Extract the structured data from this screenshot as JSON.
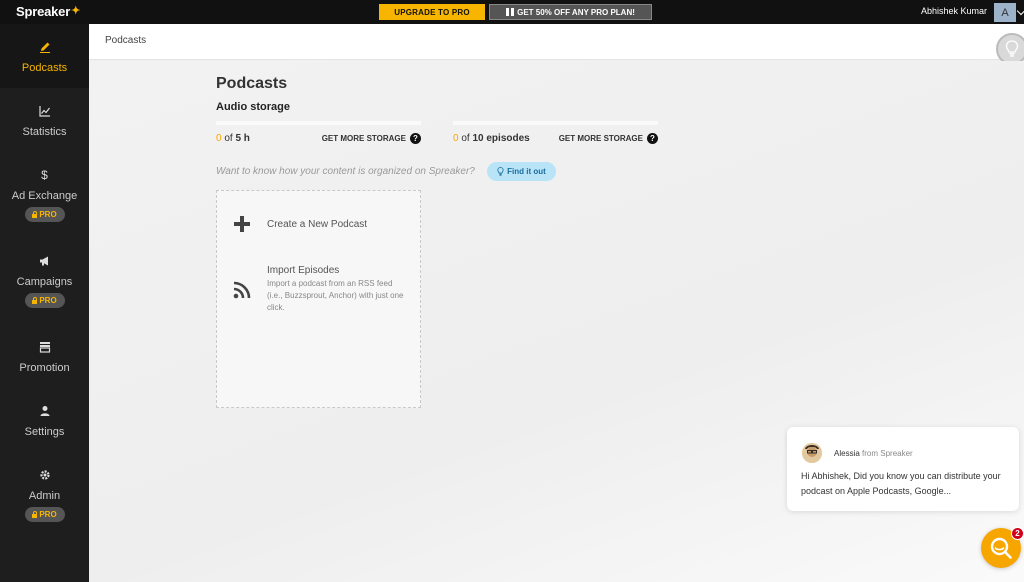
{
  "topbar": {
    "logo": "Spreaker",
    "upgrade_label": "UPGRADE TO PRO",
    "offer_label": "GET 50% OFF ANY PRO PLAN!",
    "user_name": "Abhishek Kumar",
    "avatar_initial": "A"
  },
  "sidebar": {
    "items": [
      {
        "label": "Podcasts",
        "icon": "pencil-icon",
        "active": true,
        "pro": false
      },
      {
        "label": "Statistics",
        "icon": "chart-icon",
        "active": false,
        "pro": false
      },
      {
        "label": "Ad Exchange",
        "icon": "dollar-icon",
        "active": false,
        "pro": true
      },
      {
        "label": "Campaigns",
        "icon": "megaphone-icon",
        "active": false,
        "pro": true
      },
      {
        "label": "Promotion",
        "icon": "store-icon",
        "active": false,
        "pro": false
      },
      {
        "label": "Settings",
        "icon": "user-icon",
        "active": false,
        "pro": false
      },
      {
        "label": "Admin",
        "icon": "gear-icon",
        "active": false,
        "pro": true
      }
    ],
    "pro_label": "PRO"
  },
  "breadcrumb": {
    "current": "Podcasts"
  },
  "main": {
    "title": "Podcasts",
    "audio_storage_title": "Audio storage",
    "storage_hours": {
      "used": "0",
      "of": "of",
      "total": "5 h",
      "action": "GET MORE STORAGE"
    },
    "storage_episodes": {
      "used": "0",
      "of": "of",
      "total": "10 episodes",
      "action": "GET MORE STORAGE"
    },
    "hint": "Want to know how your content is organized on Spreaker?",
    "find_out_label": "Find it out",
    "create_label": "Create a New Podcast",
    "import_title": "Import Episodes",
    "import_desc": "Import a podcast from an RSS feed (i.e., Buzzsprout, Anchor) with just one click."
  },
  "chat": {
    "agent": "Alessia",
    "from": "from Spreaker",
    "message": "Hi Abhishek, Did you know you can distribute your podcast on Apple Podcasts, Google...",
    "unread_count": "2"
  },
  "colors": {
    "accent": "#f7b500",
    "sidebar": "#1e1e1e",
    "topbar": "#111111"
  }
}
